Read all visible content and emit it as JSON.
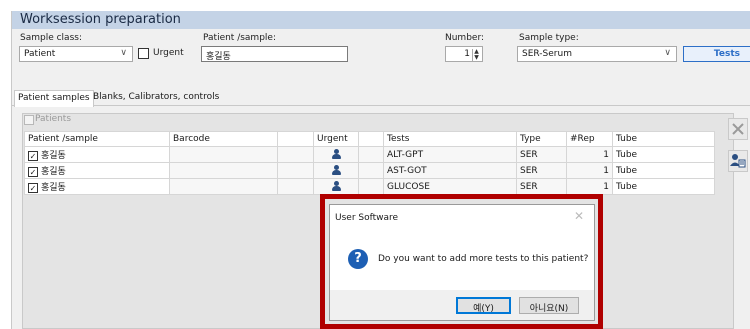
{
  "window": {
    "title": "Worksession preparation"
  },
  "header": {
    "sample_class_label": "Sample class:",
    "sample_class_value": "Patient",
    "urgent_label": "Urgent",
    "patient_label": "Patient /sample:",
    "patient_value": "홍길동",
    "number_label": "Number:",
    "number_value": "1",
    "sample_type_label": "Sample type:",
    "sample_type_value": "SER-Serum",
    "tests_button": "Tests"
  },
  "tabs": [
    {
      "label": "Patient samples"
    },
    {
      "label": "Blanks, Calibrators, controls"
    }
  ],
  "group": {
    "label": "Patients"
  },
  "table": {
    "columns": [
      "Patient /sample",
      "Barcode",
      "",
      "Urgent",
      "",
      "Tests",
      "Type",
      "#Rep",
      "Tube"
    ],
    "rows": [
      {
        "patient": "홍길동",
        "checked": "✓",
        "test": "ALT-GPT",
        "type": "SER",
        "rep": "1",
        "tube": "Tube"
      },
      {
        "patient": "홍길동",
        "checked": "✓",
        "test": "AST-GOT",
        "type": "SER",
        "rep": "1",
        "tube": "Tube"
      },
      {
        "patient": "홍길동",
        "checked": "✓",
        "test": "GLUCOSE",
        "type": "SER",
        "rep": "1",
        "tube": "Tube"
      }
    ]
  },
  "dialog": {
    "title": "User Software",
    "close": "✕",
    "icon": "?",
    "message": "Do you want to add more tests to this patient?",
    "yes": "예(Y)",
    "no": "아니요(N)"
  },
  "colors": {
    "highlight": "#b00000",
    "accent": "#1d5fb4"
  }
}
